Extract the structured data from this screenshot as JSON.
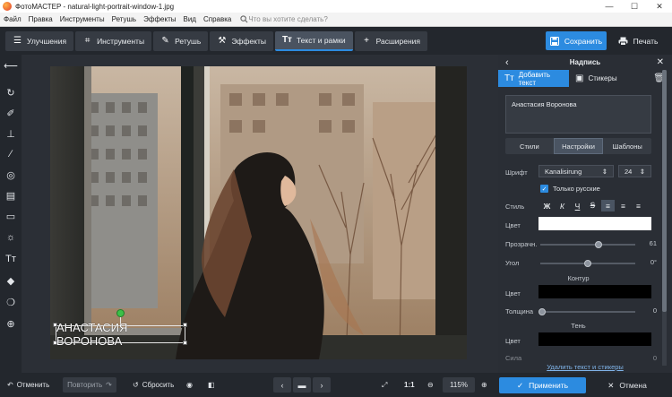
{
  "window": {
    "title": "ФотоМАСТЕР - natural-light-portrait-window-1.jpg",
    "controls": [
      "—",
      "☐",
      "✕"
    ]
  },
  "menu": {
    "items": [
      "Файл",
      "Правка",
      "Инструменты",
      "Ретушь",
      "Эффекты",
      "Вид",
      "Справка"
    ],
    "search_placeholder": "Что вы хотите сделать?"
  },
  "toolbar": {
    "tabs": [
      {
        "label": "Улучшения",
        "icon": "sliders-icon"
      },
      {
        "label": "Инструменты",
        "icon": "crop-icon"
      },
      {
        "label": "Ретушь",
        "icon": "brush-icon"
      },
      {
        "label": "Эффекты",
        "icon": "wand-icon"
      },
      {
        "label": "Текст и рамки",
        "icon": "text-icon"
      },
      {
        "label": "Расширения",
        "icon": "plus-icon"
      }
    ],
    "active_tab": "Текст и рамки",
    "save_label": "Сохранить",
    "print_label": "Печать"
  },
  "canvas": {
    "caption_text": "АНАСТАСИЯ ВОРОНОВА"
  },
  "panel": {
    "title": "Надпись",
    "tab_add_text": "Добавить текст",
    "tab_stickers": "Стикеры",
    "text_value": "Анастасия Воронова",
    "segments": [
      "Стили",
      "Настройки",
      "Шаблоны"
    ],
    "active_segment": "Настройки",
    "font_label": "Шрифт",
    "font_value": "Kanalisirung",
    "size_value": "24",
    "only_russian_label": "Только русские",
    "only_russian_checked": true,
    "style_label": "Стиль",
    "style_buttons": [
      "Ж",
      "К",
      "Ч",
      "Ꞩ"
    ],
    "color_label": "Цвет",
    "text_color": "#ffffff",
    "opacity_label": "Прозрачн.",
    "opacity_value": "61",
    "opacity_fraction": 0.61,
    "angle_label": "Угол",
    "angle_value": "0°",
    "angle_fraction": 0.5,
    "contour_title": "Контур",
    "contour_color_label": "Цвет",
    "contour_color": "#000000",
    "thickness_label": "Толщина",
    "thickness_value": "0",
    "shadow_title": "Тень",
    "shadow_color_label": "Цвет",
    "shadow_color": "#000000",
    "shadow_partial_label": "Сила",
    "shadow_partial_value": "0",
    "delete_link": "Удалить текст и стикеры"
  },
  "bottom": {
    "undo_label": "Отменить",
    "redo_label": "Повторить",
    "reset_label": "Сбросить",
    "ratio_label": "1:1",
    "zoom_value": "115%",
    "apply_label": "Применить",
    "cancel_label": "Отмена"
  },
  "colors": {
    "accent": "#2c8be0",
    "panel_bg": "#2a2e35",
    "toolbar_bg": "#23272d"
  }
}
